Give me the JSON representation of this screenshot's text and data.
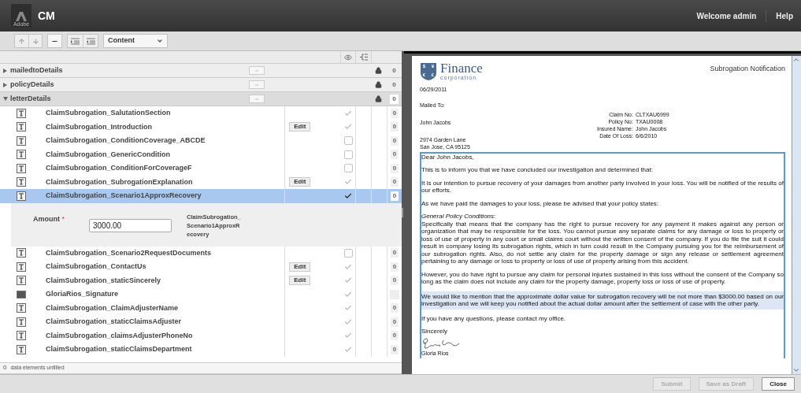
{
  "header": {
    "logo_text": "Adobe",
    "title": "CM",
    "welcome": "Welcome admin",
    "help": "Help"
  },
  "toolbar": {
    "view_select": "Content"
  },
  "groups": [
    {
      "name": "mailedtoDetails",
      "expanded": false,
      "count": "0"
    },
    {
      "name": "policyDetails",
      "expanded": false,
      "count": "0"
    },
    {
      "name": "letterDetails",
      "expanded": true,
      "count": "0",
      "items": [
        {
          "kind": "text",
          "name": "ClaimSubrogation_SalutationSection",
          "checked": true,
          "selected": false,
          "count": "0"
        },
        {
          "kind": "text",
          "name": "ClaimSubrogation_Introduction",
          "edit": "Edit",
          "checked": true,
          "selected": false,
          "count": "0"
        },
        {
          "kind": "text",
          "name": "ClaimSubrogation_ConditionCoverage_ABCDE",
          "checked": false,
          "selected": false,
          "count": "0"
        },
        {
          "kind": "text",
          "name": "ClaimSubrogation_GenericCondition",
          "checked": false,
          "selected": false,
          "count": "0"
        },
        {
          "kind": "text",
          "name": "ClaimSubrogation_ConditionForCoverageF",
          "checked": false,
          "selected": false,
          "count": "0"
        },
        {
          "kind": "text",
          "name": "ClaimSubrogation_SubrogationExplanation",
          "edit": "Edit",
          "checked": true,
          "selected": false,
          "count": "0"
        },
        {
          "kind": "text",
          "name": "ClaimSubrogation_Scenario1ApproxRecovery",
          "checked": true,
          "selected": true,
          "count": "0",
          "field": {
            "label": "Amount",
            "required_mark": "*",
            "value": "3000.00",
            "caption": "ClaimSubrogation_Scenario1ApproxRecovery"
          }
        },
        {
          "kind": "text",
          "name": "ClaimSubrogation_Scenario2RequestDocuments",
          "checked": false,
          "selected": false,
          "count": "0"
        },
        {
          "kind": "text",
          "name": "ClaimSubrogation_ContactUs",
          "edit": "Edit",
          "checked": true,
          "selected": false,
          "count": "0"
        },
        {
          "kind": "text",
          "name": "ClaimSubrogation_staticSincerely",
          "edit": "Edit",
          "checked": true,
          "selected": false,
          "count": "0"
        },
        {
          "kind": "image",
          "name": "GloriaRios_Signature",
          "checked": true,
          "selected": false
        },
        {
          "kind": "text",
          "name": "ClaimSubrogation_ClaimAdjusterName",
          "checked": true,
          "selected": false,
          "count": "0"
        },
        {
          "kind": "text",
          "name": "ClaimSubrogation_staticClaimsAdjuster",
          "checked": true,
          "selected": false,
          "count": "0"
        },
        {
          "kind": "text",
          "name": "ClaimSubrogation_claimsAdjusterPhoneNo",
          "checked": true,
          "selected": false,
          "count": "0"
        },
        {
          "kind": "text",
          "name": "ClaimSubrogation_staticClaimsDepartment",
          "checked": true,
          "selected": false,
          "count": "0"
        }
      ]
    }
  ],
  "status": {
    "count": "0",
    "text": "data elements unfilled"
  },
  "letter": {
    "logo_symbols": [
      "$",
      "¥",
      "€",
      "£"
    ],
    "logo_name": "Finance",
    "logo_sub": "corporation",
    "heading": "Subrogation Notification",
    "date": "06/29/2011",
    "mailed_label": "Mailed To:",
    "recipient": "John Jacobs",
    "address": [
      "2974 Garden Lane",
      "San Jose, CA 95125"
    ],
    "claim_info": [
      {
        "label": "Claim No:",
        "value": "CLTXAU6999"
      },
      {
        "label": "Policy No:",
        "value": "TXAU0008"
      },
      {
        "label": "Insured Name:",
        "value": "John Jacobs"
      },
      {
        "label": "Date Of Loss:",
        "value": "6/6/2010"
      }
    ],
    "paragraphs": [
      {
        "text": "Dear John Jacobs,",
        "highlighted": false
      },
      {
        "text": "This is to inform you that we have concluded our investigation and determined that:",
        "highlighted": false
      },
      {
        "text": "It is our intention to pursue recovery of your damages from another party involved in your loss. You will be notified of the results of our efforts.",
        "highlighted": false
      },
      {
        "text": "As we have paid the damages to your loss, please be advised that your policy states:",
        "highlighted": false
      },
      {
        "text": "*General Policy Conditions*:\nSpecifically that means that the company has the right to pursue recovery for any payment it makes against any person or organization that may be responsible for the loss. You cannot pursue any separate claims for any damage or loss to property or loss of use of property in any court or small claims court without the written consent of the company. If you do file the suit it could result in company losing its subrogation rights, which in turn could result in the Company pursuing you for the reimbursement of our subrogation rights. Also, do not settle any claim for the property damage or sign any release or settlement agreement pertaining to any damage or loss to property or loss of use of property arising from this accident.",
        "highlighted": false
      },
      {
        "text": "However, you do have right to pursue any claim for personal injuries sustained in this loss without the consent of the Company so long as the claim does not include any claim for the property damage, property loss or loss of use of property.",
        "highlighted": false
      },
      {
        "text": "We would like to mention that the approximate dollar value for subrogation recovery will be not more than $3000.00 based on our investigation and we will keep you notified about the actual dollar amount after the settlement of case with the other party.",
        "highlighted": true
      },
      {
        "text": "If you have any questions, please contact my office.",
        "highlighted": false
      },
      {
        "text": "Sincerely",
        "highlighted": false
      }
    ],
    "signer": "Gloria Rios"
  },
  "actions": [
    {
      "label": "Submit",
      "disabled": true
    },
    {
      "label": "Save as Draft",
      "disabled": true
    },
    {
      "label": "Close",
      "disabled": false
    }
  ]
}
